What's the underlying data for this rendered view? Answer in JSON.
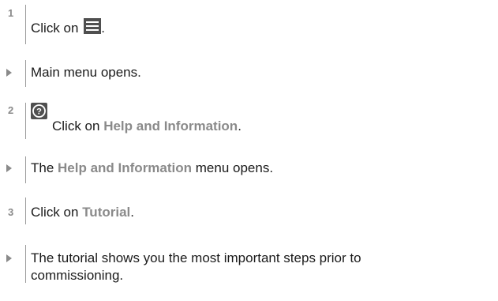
{
  "steps": [
    {
      "kind": "number",
      "marker": "1",
      "text_before": "Click on ",
      "icon": "menu-icon",
      "text_after": "."
    },
    {
      "kind": "result",
      "text": "Main menu opens."
    },
    {
      "kind": "number",
      "marker": "2",
      "icon": "help-icon",
      "text_before": "Click on ",
      "highlight": "Help and Information",
      "text_after": "."
    },
    {
      "kind": "result",
      "text_before": "The ",
      "highlight": "Help and Information",
      "text_after": " menu opens."
    },
    {
      "kind": "number",
      "marker": "3",
      "text_before": "Click on ",
      "highlight": "Tutorial",
      "text_after": "."
    },
    {
      "kind": "result",
      "line1": "The tutorial shows you the most important steps prior to",
      "line2": "commissioning."
    }
  ],
  "colors": {
    "text": "#1a1a1a",
    "highlight": "#8a8a8a",
    "marker": "#8a8a8a",
    "icon_bg": "#4f4f4f"
  }
}
